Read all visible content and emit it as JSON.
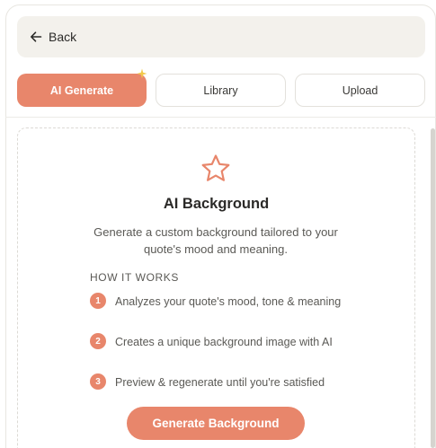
{
  "header": {
    "back_label": "Back"
  },
  "tabs": [
    {
      "label": "AI Generate",
      "active": true
    },
    {
      "label": "Library",
      "active": false
    },
    {
      "label": "Upload",
      "active": false
    }
  ],
  "card": {
    "title": "AI Background",
    "description": "Generate a custom background tailored to your quote's mood and meaning.",
    "how_title": "HOW IT WORKS",
    "steps": [
      {
        "num": "1",
        "text": "Analyzes your quote's mood, tone & meaning"
      },
      {
        "num": "2",
        "text": "Creates a unique background image with AI"
      },
      {
        "num": "3",
        "text": "Preview & regenerate until you're satisfied"
      }
    ],
    "button_label": "Generate Background"
  },
  "colors": {
    "accent": "#e8866b",
    "sparkle": "#f2c94c",
    "surface": "#f3f1ec"
  },
  "icons": {
    "back": "arrow-left-icon",
    "tab_badge": "sparkle-icon",
    "card": "star-icon"
  }
}
